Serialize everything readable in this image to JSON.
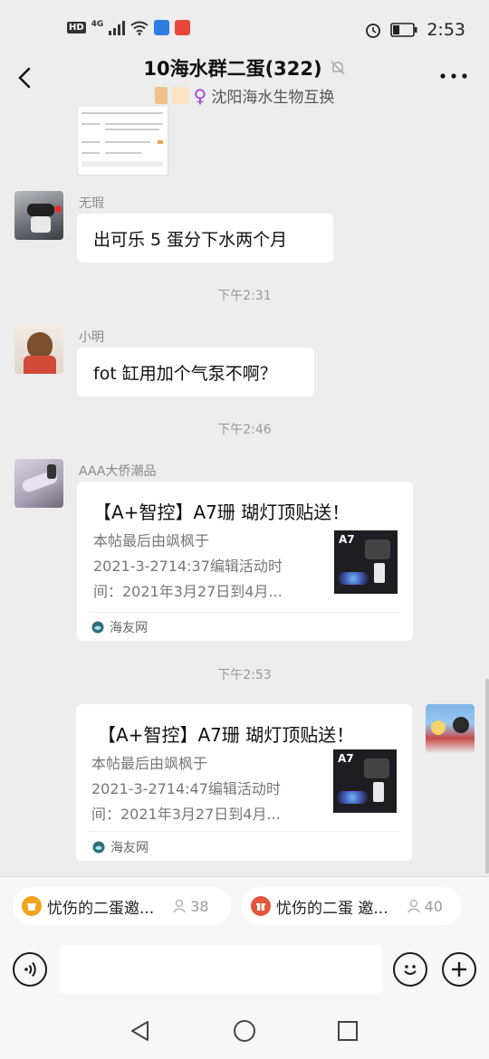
{
  "status_bar": {
    "signal_label": "HD",
    "network": "4G",
    "time": "2:53"
  },
  "header": {
    "group_title": "10海水群二蛋(322)",
    "group_subtitle": "沈阳海水生物互换"
  },
  "messages": {
    "m1": {
      "sender": "无瑕",
      "text": "出可乐 5 蛋分下水两个月"
    },
    "t1": "下午2:31",
    "m2": {
      "sender": "小明",
      "text": "fot 缸用加个气泵不啊？"
    },
    "t2": "下午2:46",
    "m3": {
      "sender": "AAA大侨潮品",
      "card_title": "【A+智控】A7珊 瑚灯顶贴送！",
      "card_desc_1": "本帖最后由飒枫于",
      "card_desc_2": "2021-3-2714:37编辑活动时",
      "card_desc_3": "间：2021年3月27日到4月...",
      "thumb_label": "A7",
      "source": "海友网"
    },
    "t3": "下午2:53",
    "m4": {
      "card_title": "【A+智控】A7珊 瑚灯顶贴送！",
      "card_desc_1": "本帖最后由飒枫于",
      "card_desc_2": "2021-3-2714:47编辑活动时",
      "card_desc_3": "间：2021年3月27日到4月...",
      "thumb_label": "A7",
      "source": "海友网"
    }
  },
  "bottom_pills": [
    {
      "label": "忧伤的二蛋邀...",
      "count": "38"
    },
    {
      "label": "忧伤的二蛋 邀...",
      "count": "40"
    }
  ],
  "input": {
    "placeholder": ""
  },
  "icons": {
    "back": "chevron-left-icon",
    "more": "more-icon",
    "mute": "bell-off-icon",
    "voice": "voice-icon",
    "emoji": "emoji-icon",
    "plus": "plus-icon"
  },
  "colors": {
    "background": "#ededed",
    "bubble": "#ffffff",
    "time_text": "#999999",
    "shield_blue": "#2f7de1",
    "app_red": "#e8453c"
  }
}
